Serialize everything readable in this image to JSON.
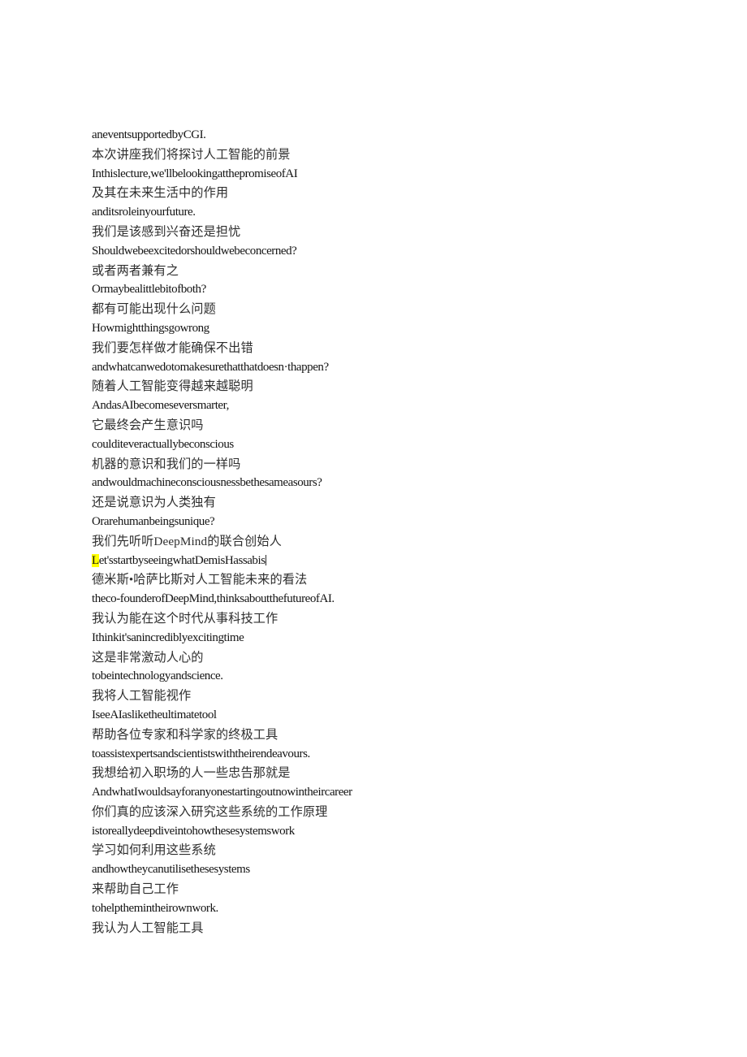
{
  "document": {
    "background_color": "#ffffff",
    "text_color_latin": "#141414",
    "text_color_cjk": "#2e2e2e",
    "highlight_color": "#ffff00",
    "lines": [
      {
        "lang": "en",
        "text": "aneventsupportedbyCGI."
      },
      {
        "lang": "zh",
        "text": "本次讲座我们将探讨人工智能的前景"
      },
      {
        "lang": "en",
        "text": "Inthislecture,we'llbelookingatthepromiseofAI"
      },
      {
        "lang": "zh",
        "text": "及其在未来生活中的作用"
      },
      {
        "lang": "en",
        "text": "anditsroleinyourfuture."
      },
      {
        "lang": "zh",
        "text": "我们是该感到兴奋还是担忧"
      },
      {
        "lang": "en",
        "text": "Shouldwebeexcitedorshouldwebeconcerned?"
      },
      {
        "lang": "zh",
        "text": "或者两者兼有之"
      },
      {
        "lang": "en",
        "text": "Ormaybealittlebitofboth?"
      },
      {
        "lang": "zh",
        "text": "都有可能出现什么问题"
      },
      {
        "lang": "en",
        "text": "Howmightthingsgowrong"
      },
      {
        "lang": "zh",
        "text": "我们要怎样做才能确保不出错"
      },
      {
        "lang": "en",
        "text": "andwhatcanwedotomakesurethatthatdoesn·thappen?"
      },
      {
        "lang": "zh",
        "text": "随着人工智能变得越来越聪明"
      },
      {
        "lang": "en",
        "text": "AndasAIbecomeseversmarter,"
      },
      {
        "lang": "zh",
        "text": "它最终会产生意识吗"
      },
      {
        "lang": "en",
        "text": "coulditeveractuallybeconscious"
      },
      {
        "lang": "zh",
        "text": "机器的意识和我们的一样吗"
      },
      {
        "lang": "en",
        "text": "andwouldmachineconsciousnessbethesameasours?"
      },
      {
        "lang": "zh",
        "text": "还是说意识为人类独有"
      },
      {
        "lang": "en",
        "text": "Orarehumanbeingsunique?"
      },
      {
        "lang": "zh",
        "text": "我们先听听DeepMind的联合创始人"
      },
      {
        "lang": "en",
        "text": "et'sstartbyseeingwhatDemisHassabis",
        "highlight_first": "L",
        "caret_after": true
      },
      {
        "lang": "zh",
        "text": "德米斯•哈萨比斯对人工智能未来的看法"
      },
      {
        "lang": "en",
        "text": "theco-founderofDeepMind,thinksaboutthefutureofAI."
      },
      {
        "lang": "zh",
        "text": "我认为能在这个时代从事科技工作"
      },
      {
        "lang": "en",
        "text": "Ithinkit'sanincrediblyexcitingtime"
      },
      {
        "lang": "zh",
        "text": "这是非常激动人心的"
      },
      {
        "lang": "en",
        "text": "tobeintechnologyandscience."
      },
      {
        "lang": "zh",
        "text": "我将人工智能视作"
      },
      {
        "lang": "en",
        "text": "IseeAIasliketheultimatetool"
      },
      {
        "lang": "zh",
        "text": "帮助各位专家和科学家的终极工具"
      },
      {
        "lang": "en",
        "text": "toassistexpertsandscientistswiththeirendeavours."
      },
      {
        "lang": "zh",
        "text": "我想给初入职场的人一些忠告那就是"
      },
      {
        "lang": "en",
        "text": "AndwhatIwouldsayforanyonestartingoutnowintheircareer"
      },
      {
        "lang": "zh",
        "text": "你们真的应该深入研究这些系统的工作原理"
      },
      {
        "lang": "en",
        "text": "istoreallydeepdiveintohowthesesystemswork"
      },
      {
        "lang": "zh",
        "text": "学习如何利用这些系统"
      },
      {
        "lang": "en",
        "text": "andhowtheycanutilisethesesystems"
      },
      {
        "lang": "zh",
        "text": "来帮助自己工作"
      },
      {
        "lang": "en",
        "text": "tohelpthemintheirownwork."
      },
      {
        "lang": "zh",
        "text": "我认为人工智能工具"
      }
    ]
  }
}
